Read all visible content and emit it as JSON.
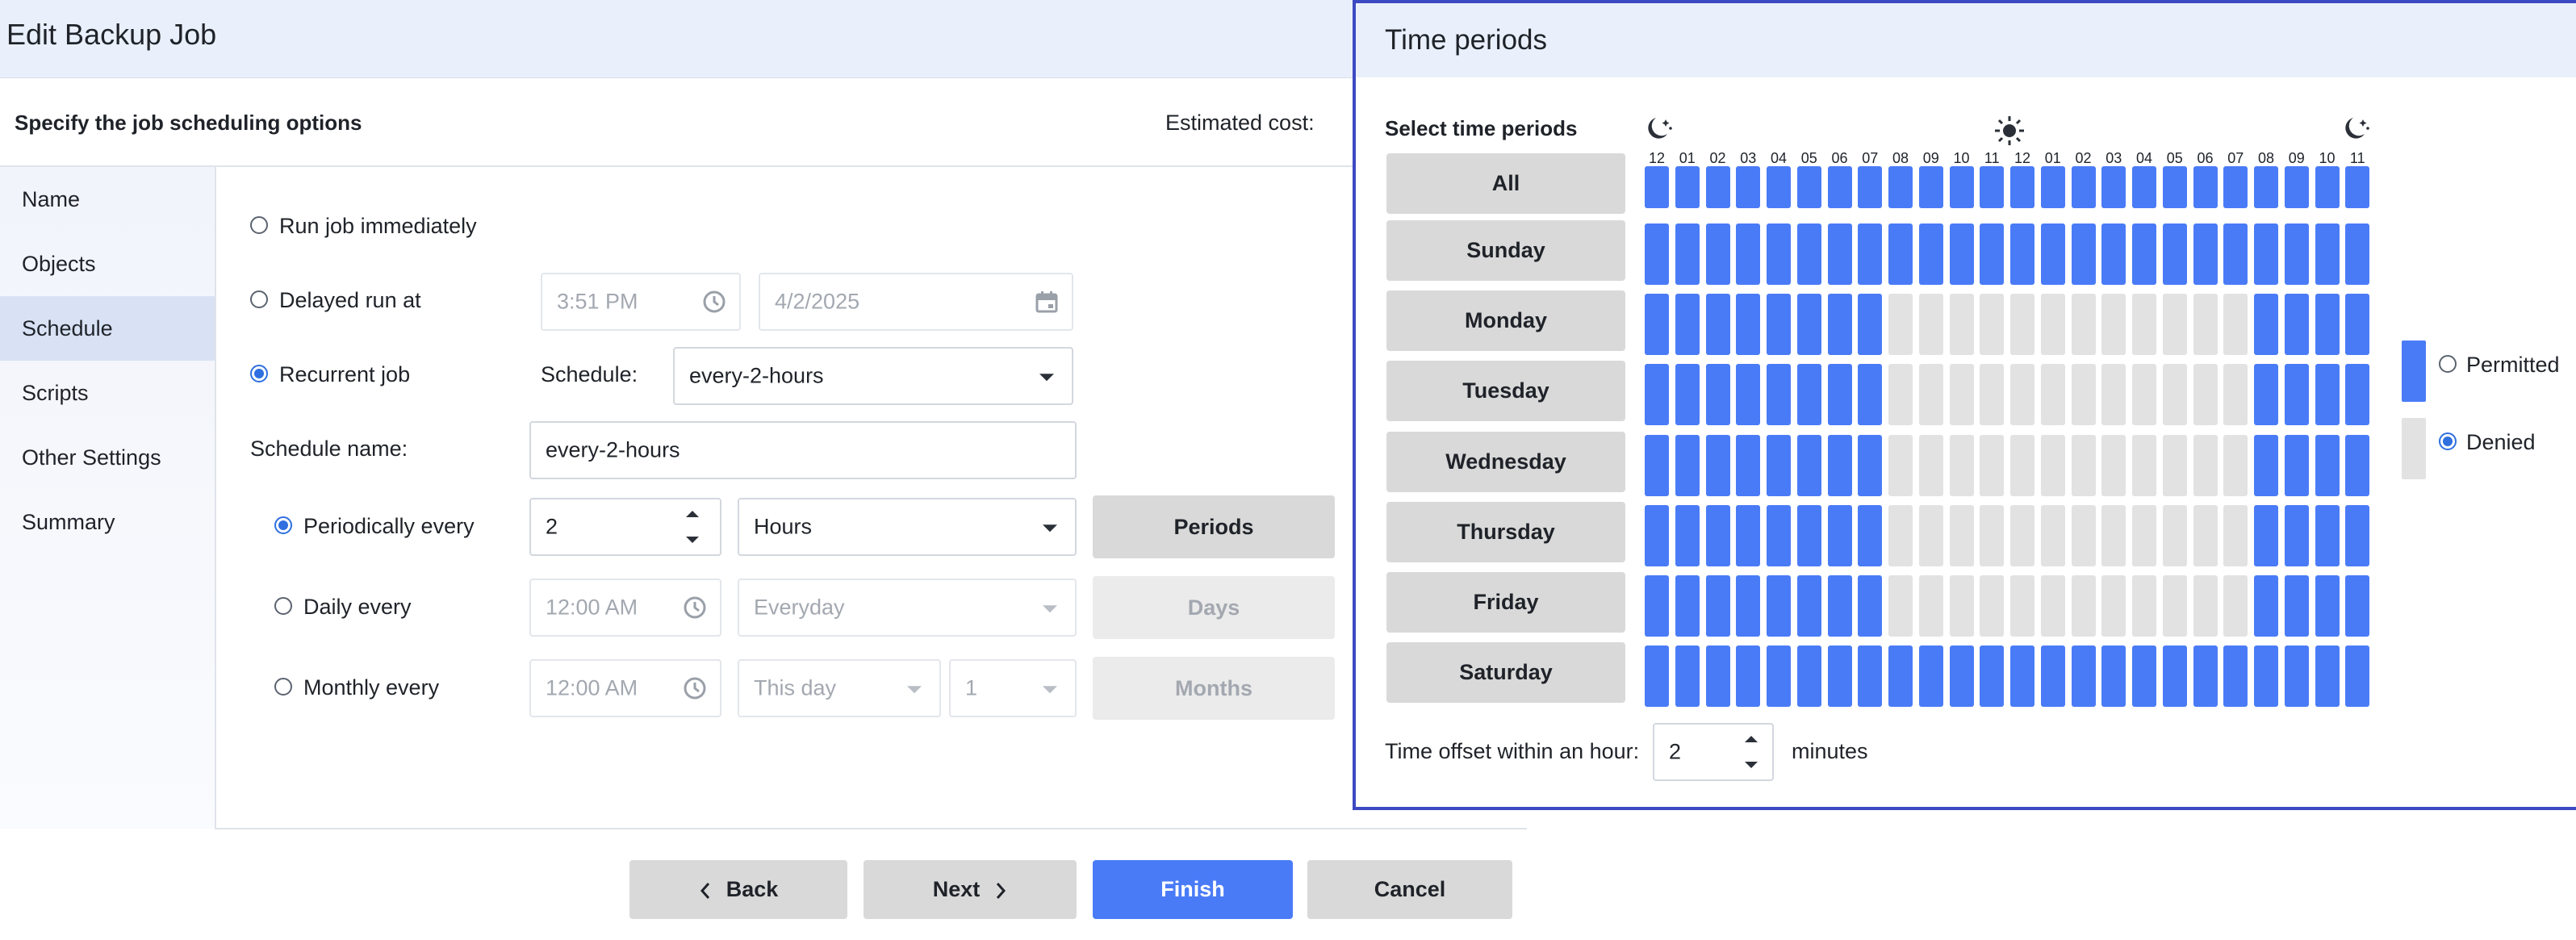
{
  "dialog": {
    "title": "Edit Backup Job",
    "subtitle": "Specify the job scheduling options",
    "estimated_cost_label": "Estimated cost:"
  },
  "sidebar": {
    "items": [
      {
        "label": "Name"
      },
      {
        "label": "Objects"
      },
      {
        "label": "Schedule",
        "active": true
      },
      {
        "label": "Scripts"
      },
      {
        "label": "Other Settings"
      },
      {
        "label": "Summary"
      }
    ]
  },
  "schedule": {
    "run_immediately_label": "Run job immediately",
    "delayed_run_label": "Delayed run at",
    "delayed_time": "3:51 PM",
    "delayed_date": "4/2/2025",
    "recurrent_label": "Recurrent job",
    "schedule_label": "Schedule:",
    "schedule_value": "every-2-hours",
    "schedule_name_label": "Schedule name:",
    "schedule_name_value": "every-2-hours",
    "selected_mode": "recurrent",
    "periodically": {
      "label": "Periodically every",
      "value": "2",
      "unit": "Hours",
      "button": "Periods",
      "selected": true
    },
    "daily": {
      "label": "Daily every",
      "time": "12:00 AM",
      "frequency": "Everyday",
      "button": "Days"
    },
    "monthly": {
      "label": "Monthly every",
      "time": "12:00 AM",
      "day_option": "This day",
      "day_number": "1",
      "button": "Months"
    }
  },
  "footer": {
    "back": "Back",
    "next": "Next",
    "finish": "Finish",
    "cancel": "Cancel"
  },
  "time_periods": {
    "title": "Time periods",
    "select_label": "Select time periods",
    "all_label": "All",
    "hours": [
      "12",
      "01",
      "02",
      "03",
      "04",
      "05",
      "06",
      "07",
      "08",
      "09",
      "10",
      "11",
      "12",
      "01",
      "02",
      "03",
      "04",
      "05",
      "06",
      "07",
      "08",
      "09",
      "10",
      "11"
    ],
    "days": [
      {
        "label": "Sunday",
        "permitted": [
          1,
          1,
          1,
          1,
          1,
          1,
          1,
          1,
          1,
          1,
          1,
          1,
          1,
          1,
          1,
          1,
          1,
          1,
          1,
          1,
          1,
          1,
          1,
          1
        ]
      },
      {
        "label": "Monday",
        "permitted": [
          1,
          1,
          1,
          1,
          1,
          1,
          1,
          1,
          0,
          0,
          0,
          0,
          0,
          0,
          0,
          0,
          0,
          0,
          0,
          0,
          1,
          1,
          1,
          1
        ]
      },
      {
        "label": "Tuesday",
        "permitted": [
          1,
          1,
          1,
          1,
          1,
          1,
          1,
          1,
          0,
          0,
          0,
          0,
          0,
          0,
          0,
          0,
          0,
          0,
          0,
          0,
          1,
          1,
          1,
          1
        ]
      },
      {
        "label": "Wednesday",
        "permitted": [
          1,
          1,
          1,
          1,
          1,
          1,
          1,
          1,
          0,
          0,
          0,
          0,
          0,
          0,
          0,
          0,
          0,
          0,
          0,
          0,
          1,
          1,
          1,
          1
        ]
      },
      {
        "label": "Thursday",
        "permitted": [
          1,
          1,
          1,
          1,
          1,
          1,
          1,
          1,
          0,
          0,
          0,
          0,
          0,
          0,
          0,
          0,
          0,
          0,
          0,
          0,
          1,
          1,
          1,
          1
        ]
      },
      {
        "label": "Friday",
        "permitted": [
          1,
          1,
          1,
          1,
          1,
          1,
          1,
          1,
          0,
          0,
          0,
          0,
          0,
          0,
          0,
          0,
          0,
          0,
          0,
          0,
          1,
          1,
          1,
          1
        ]
      },
      {
        "label": "Saturday",
        "permitted": [
          1,
          1,
          1,
          1,
          1,
          1,
          1,
          1,
          1,
          1,
          1,
          1,
          1,
          1,
          1,
          1,
          1,
          1,
          1,
          1,
          1,
          1,
          1,
          1
        ]
      }
    ],
    "legend": {
      "permitted": "Permitted",
      "denied": "Denied",
      "selected": "denied"
    },
    "offset_label": "Time offset within an hour:",
    "offset_value": "2",
    "offset_unit": "minutes",
    "icons": [
      "moon-stars-icon",
      "sun-icon",
      "moon-stars-icon"
    ]
  },
  "colors": {
    "accent": "#4a7bf7",
    "permitted": "#4a7bf7",
    "denied": "#e2e2e2",
    "panel_border": "#3d49c2",
    "header_bg": "#eaf0fb"
  }
}
